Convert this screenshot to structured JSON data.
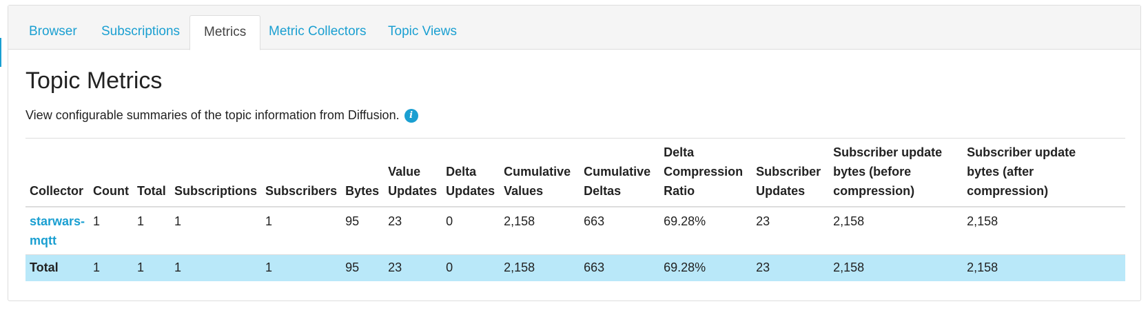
{
  "tabs": [
    {
      "label": "Browser",
      "active": false
    },
    {
      "label": "Subscriptions",
      "active": false
    },
    {
      "label": "Metrics",
      "active": true
    },
    {
      "label": "Metric Collectors",
      "active": false
    },
    {
      "label": "Topic Views",
      "active": false
    }
  ],
  "page": {
    "title": "Topic Metrics",
    "description": "View configurable summaries of the topic information from Diffusion.",
    "info_icon": "info-icon"
  },
  "table": {
    "headers": [
      [
        "Collector"
      ],
      [
        "Count"
      ],
      [
        "Total"
      ],
      [
        "Subscriptions"
      ],
      [
        "Subscribers"
      ],
      [
        "Bytes"
      ],
      [
        "Value",
        "Updates"
      ],
      [
        "Delta",
        "Updates"
      ],
      [
        "Cumulative",
        "Values"
      ],
      [
        "Cumulative",
        "Deltas"
      ],
      [
        "Delta",
        "Compression",
        "Ratio"
      ],
      [
        "Subscriber",
        "Updates"
      ],
      [
        "Subscriber update",
        "bytes (before",
        "compression)"
      ],
      [
        "Subscriber update",
        "bytes (after",
        "compression)"
      ]
    ],
    "rows": [
      {
        "collector": [
          "starwars-",
          "mqtt"
        ],
        "count": "1",
        "total": "1",
        "subscriptions": "1",
        "subscribers": "1",
        "bytes": "95",
        "value_updates": "23",
        "delta_updates": "0",
        "cumulative_values": "2,158",
        "cumulative_deltas": "663",
        "delta_compression_ratio": "69.28%",
        "subscriber_updates": "23",
        "bytes_before": "2,158",
        "bytes_after": "2,158"
      }
    ],
    "total_row": {
      "label": "Total",
      "count": "1",
      "total": "1",
      "subscriptions": "1",
      "subscribers": "1",
      "bytes": "95",
      "value_updates": "23",
      "delta_updates": "0",
      "cumulative_values": "2,158",
      "cumulative_deltas": "663",
      "delta_compression_ratio": "69.28%",
      "subscriber_updates": "23",
      "bytes_before": "2,158",
      "bytes_after": "2,158"
    }
  },
  "colors": {
    "accent": "#1a9fd1",
    "total_row_bg": "#b9e8f9",
    "tabbar_bg": "#f5f5f5",
    "border": "#dddddd"
  }
}
